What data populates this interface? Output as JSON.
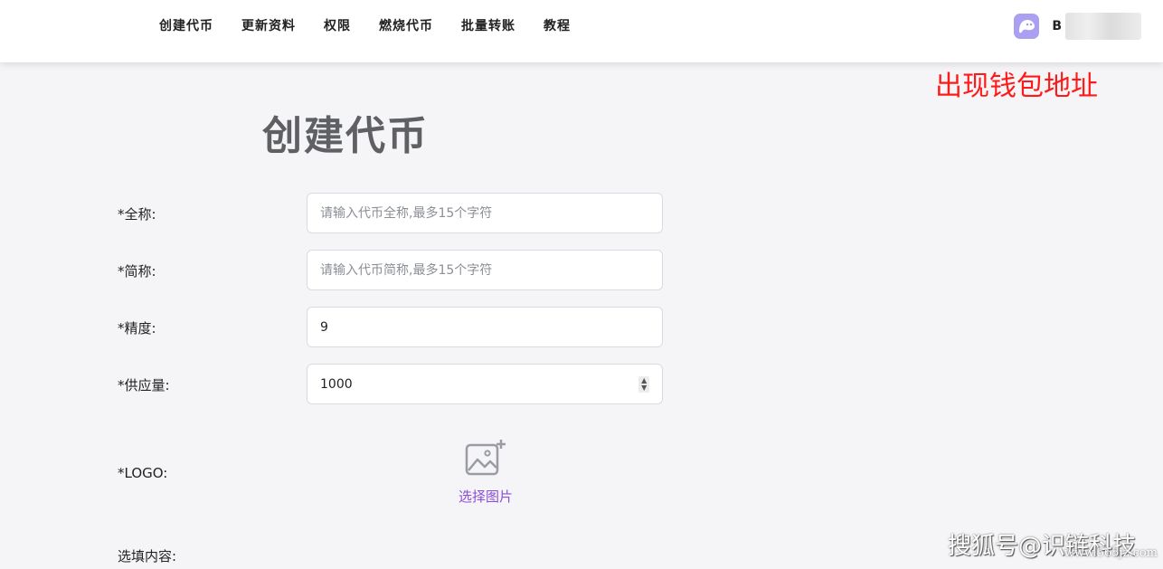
{
  "nav": {
    "items": [
      {
        "label": "创建代币"
      },
      {
        "label": "更新资料"
      },
      {
        "label": "权限"
      },
      {
        "label": "燃烧代币"
      },
      {
        "label": "批量转账"
      },
      {
        "label": "教程"
      }
    ]
  },
  "wallet": {
    "address_prefix": "B",
    "icon": "phantom-wallet-icon",
    "accent_color": "#ab9ff2"
  },
  "annotation": {
    "text": "出现钱包地址",
    "color": "#ff1a1a"
  },
  "page": {
    "title": "创建代币"
  },
  "form": {
    "full_name": {
      "label": "*全称:",
      "placeholder": "请输入代币全称,最多15个字符",
      "value": ""
    },
    "short_name": {
      "label": "*简称:",
      "placeholder": "请输入代币简称,最多15个字符",
      "value": ""
    },
    "decimals": {
      "label": "*精度:",
      "value": "9"
    },
    "supply": {
      "label": "*供应量:",
      "value": "1000"
    },
    "logo": {
      "label": "*LOGO:",
      "upload_label": "选择图片",
      "icon": "add-image-icon"
    },
    "optional": {
      "label": "选填内容:"
    }
  },
  "watermark": {
    "text": "搜狐号@识链科技",
    "url": "www.565jz.com"
  }
}
